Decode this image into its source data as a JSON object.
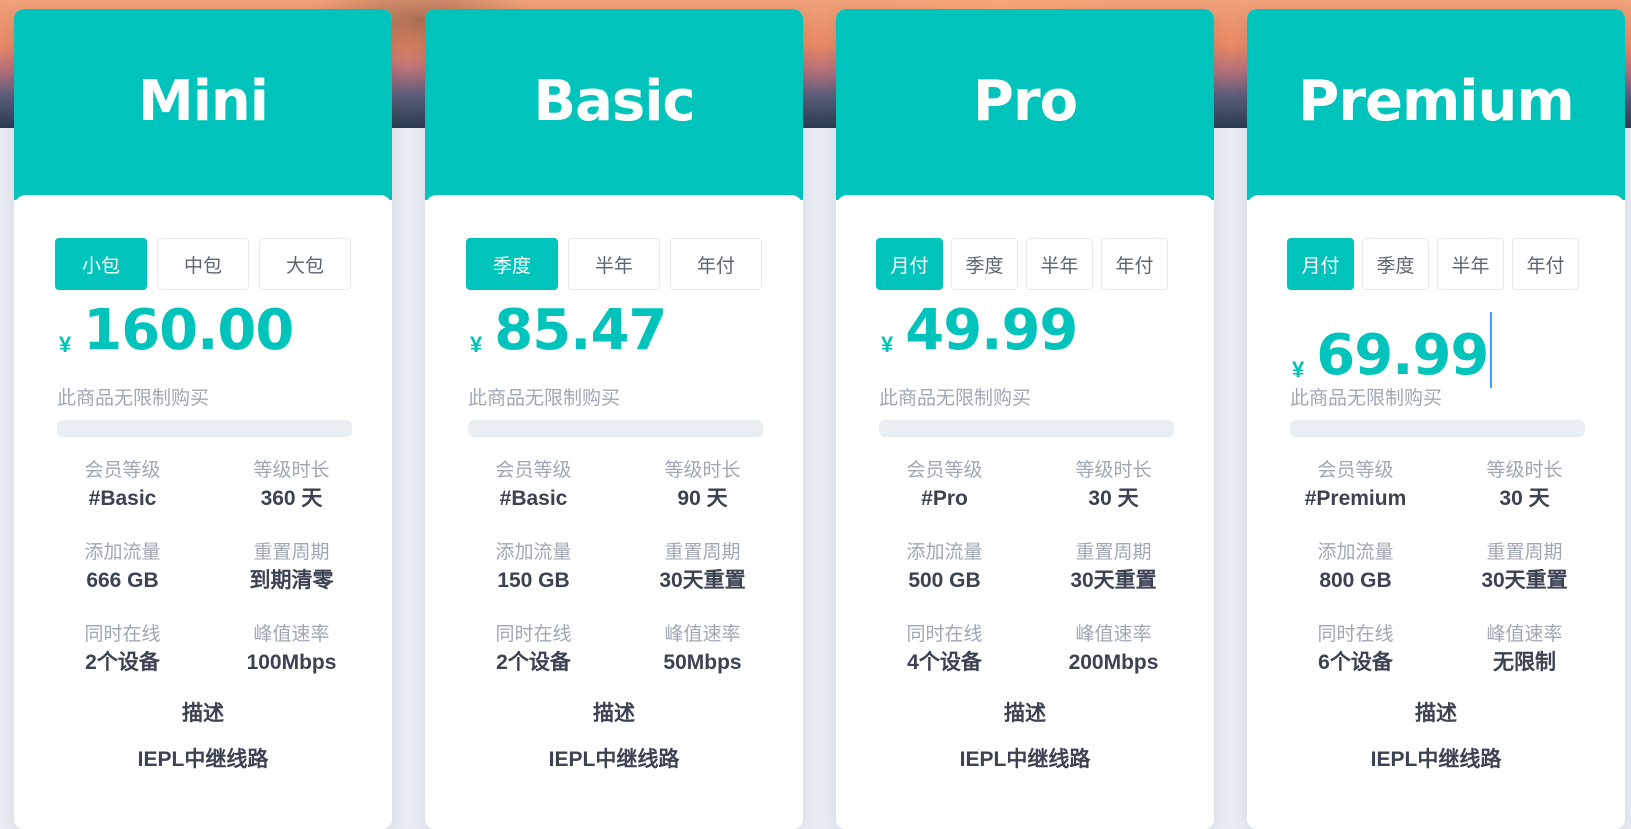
{
  "plans": [
    {
      "name": "Mini",
      "tabs": [
        "小包",
        "中包",
        "大包"
      ],
      "active_tab": 0,
      "currency": "¥",
      "price": "160.00",
      "limit_note": "此商品无限制购买",
      "progress": 0,
      "specs": [
        {
          "label": "会员等级",
          "value": "#Basic"
        },
        {
          "label": "等级时长",
          "value": "360 天"
        },
        {
          "label": "添加流量",
          "value": "666 GB"
        },
        {
          "label": "重置周期",
          "value": "到期清零"
        },
        {
          "label": "同时在线",
          "value": "2个设备"
        },
        {
          "label": "峰值速率",
          "value": "100Mbps"
        }
      ],
      "desc_title": "描述",
      "desc": "IEPL中继线路"
    },
    {
      "name": "Basic",
      "tabs": [
        "季度",
        "半年",
        "年付"
      ],
      "active_tab": 0,
      "currency": "¥",
      "price": "85.47",
      "limit_note": "此商品无限制购买",
      "progress": 0,
      "specs": [
        {
          "label": "会员等级",
          "value": "#Basic"
        },
        {
          "label": "等级时长",
          "value": "90 天"
        },
        {
          "label": "添加流量",
          "value": "150 GB"
        },
        {
          "label": "重置周期",
          "value": "30天重置"
        },
        {
          "label": "同时在线",
          "value": "2个设备"
        },
        {
          "label": "峰值速率",
          "value": "50Mbps"
        }
      ],
      "desc_title": "描述",
      "desc": "IEPL中继线路"
    },
    {
      "name": "Pro",
      "tabs": [
        "月付",
        "季度",
        "半年",
        "年付"
      ],
      "active_tab": 0,
      "currency": "¥",
      "price": "49.99",
      "limit_note": "此商品无限制购买",
      "progress": 0,
      "specs": [
        {
          "label": "会员等级",
          "value": "#Pro"
        },
        {
          "label": "等级时长",
          "value": "30 天"
        },
        {
          "label": "添加流量",
          "value": "500 GB"
        },
        {
          "label": "重置周期",
          "value": "30天重置"
        },
        {
          "label": "同时在线",
          "value": "4个设备"
        },
        {
          "label": "峰值速率",
          "value": "200Mbps"
        }
      ],
      "desc_title": "描述",
      "desc": "IEPL中继线路"
    },
    {
      "name": "Premium",
      "tabs": [
        "月付",
        "季度",
        "半年",
        "年付"
      ],
      "active_tab": 0,
      "currency": "¥",
      "price": "69.99",
      "limit_note": "此商品无限制购买",
      "progress": 0,
      "specs": [
        {
          "label": "会员等级",
          "value": "#Premium"
        },
        {
          "label": "等级时长",
          "value": "30 天"
        },
        {
          "label": "添加流量",
          "value": "800 GB"
        },
        {
          "label": "重置周期",
          "value": "30天重置"
        },
        {
          "label": "同时在线",
          "value": "6个设备"
        },
        {
          "label": "峰值速率",
          "value": "无限制"
        }
      ],
      "desc_title": "描述",
      "desc": "IEPL中继线路"
    }
  ],
  "colors": {
    "accent": "#00c4bb",
    "text_dark": "#3b4252",
    "text_muted": "#a0a7b4"
  }
}
